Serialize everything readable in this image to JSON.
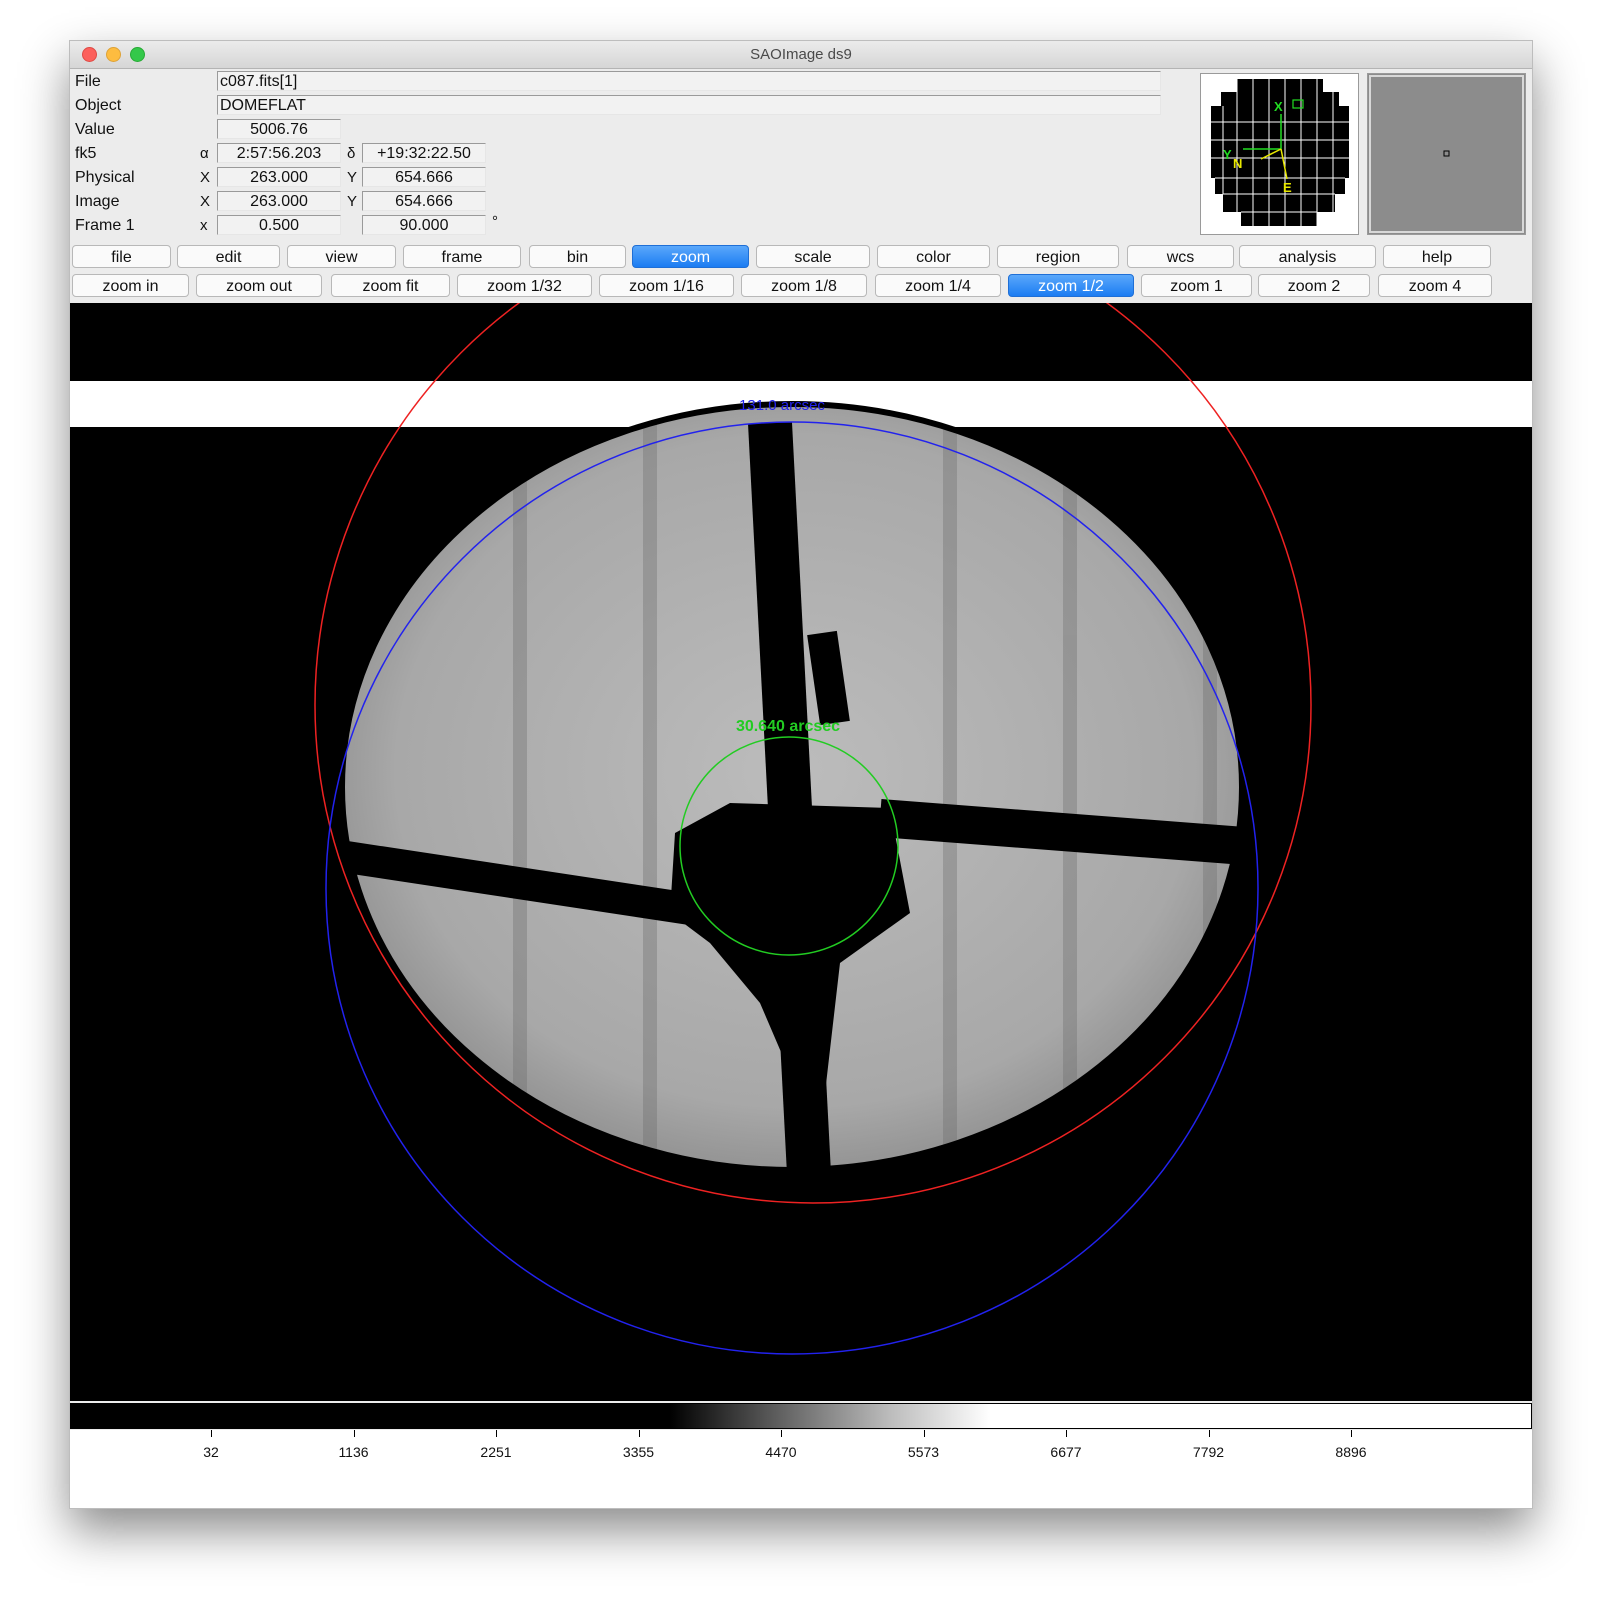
{
  "window": {
    "title": "SAOImage ds9"
  },
  "info": {
    "file_label": "File",
    "file_value": "c087.fits[1]",
    "object_label": "Object",
    "object_value": "DOMEFLAT",
    "value_label": "Value",
    "value_value": "5006.76",
    "fk5_label": "fk5",
    "alpha_sym": "α",
    "alpha_value": "2:57:56.203",
    "delta_sym": "δ",
    "delta_value": "+19:32:22.50",
    "physical_label": "Physical",
    "physical_x_sym": "X",
    "physical_x": "263.000",
    "physical_y_sym": "Y",
    "physical_y": "654.666",
    "image_label": "Image",
    "image_x_sym": "X",
    "image_x": "263.000",
    "image_y_sym": "Y",
    "image_y": "654.666",
    "frame_label": "Frame 1",
    "frame_x_sym": "x",
    "frame_zoom": "0.500",
    "frame_angle": "90.000",
    "degree_sym": "°"
  },
  "panner": {
    "compass_x": "X",
    "compass_y": "Y",
    "compass_n": "N",
    "compass_e": "E"
  },
  "menu": [
    "file",
    "edit",
    "view",
    "frame",
    "bin",
    "zoom",
    "scale",
    "color",
    "region",
    "wcs",
    "analysis",
    "help"
  ],
  "menu_active": "zoom",
  "zoom_buttons": [
    "zoom in",
    "zoom out",
    "zoom fit",
    "zoom 1/32",
    "zoom 1/16",
    "zoom 1/8",
    "zoom 1/4",
    "zoom 1/2",
    "zoom 1",
    "zoom 2",
    "zoom 4"
  ],
  "zoom_active": "zoom 1/2",
  "regions": {
    "blue_label": "131.0 arcsec",
    "green_label": "30.640 arcsec",
    "colors": {
      "blue": "#2222ee",
      "red": "#ee2222",
      "green": "#22cc22"
    }
  },
  "colorbar": {
    "labels": [
      "32",
      "1136",
      "2251",
      "3355",
      "4470",
      "5573",
      "6677",
      "7792",
      "8896"
    ]
  },
  "colors": {
    "accent": "#1b7cf2"
  }
}
